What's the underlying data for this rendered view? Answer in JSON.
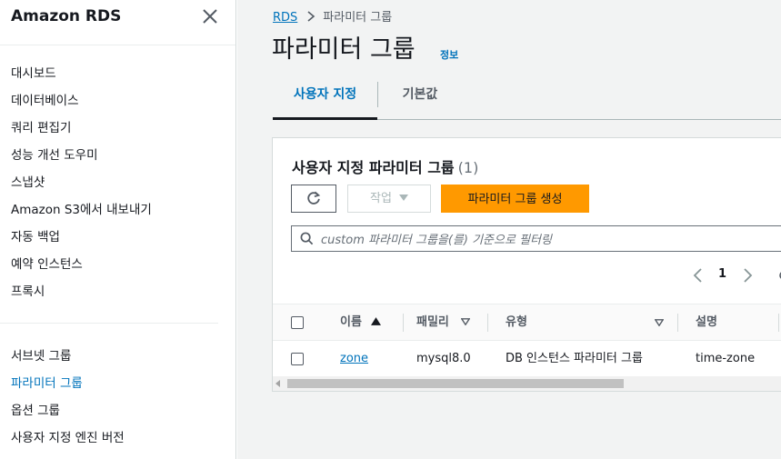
{
  "sidebar": {
    "title": "Amazon RDS",
    "items_main": [
      {
        "label": "대시보드"
      },
      {
        "label": "데이터베이스"
      },
      {
        "label": "쿼리 편집기"
      },
      {
        "label": "성능 개선 도우미"
      },
      {
        "label": "스냅샷"
      },
      {
        "label": "Amazon S3에서 내보내기"
      },
      {
        "label": "자동 백업"
      },
      {
        "label": "예약 인스턴스"
      },
      {
        "label": "프록시"
      }
    ],
    "items_config": [
      {
        "label": "서브넷 그룹"
      },
      {
        "label": "파라미터 그룹"
      },
      {
        "label": "옵션 그룹"
      },
      {
        "label": "사용자 지정 엔진 버전"
      }
    ]
  },
  "breadcrumb": {
    "root": "RDS",
    "current": "파라미터 그룹"
  },
  "page": {
    "title": "파라미터 그룹",
    "info": "정보"
  },
  "tabs": [
    {
      "label": "사용자 지정"
    },
    {
      "label": "기본값"
    }
  ],
  "panel": {
    "title": "사용자 지정 파라미터 그룹",
    "count": "(1)",
    "action_label": "작업",
    "create_label": "파라미터 그룹 생성",
    "filter_placeholder": "custom 파라미터 그룹을(를) 기준으로 필터링",
    "page_number": "1"
  },
  "table": {
    "headers": {
      "name": "이름",
      "family": "패밀리",
      "type": "유형",
      "description": "설명"
    },
    "rows": [
      {
        "name": "zone",
        "family": "mysql8.0",
        "type": "DB 인스턴스 파라미터 그룹",
        "description": "time-zone"
      }
    ]
  },
  "colors": {
    "accent": "#0073bb",
    "primary_button": "#ff9900",
    "text": "#16191f"
  }
}
